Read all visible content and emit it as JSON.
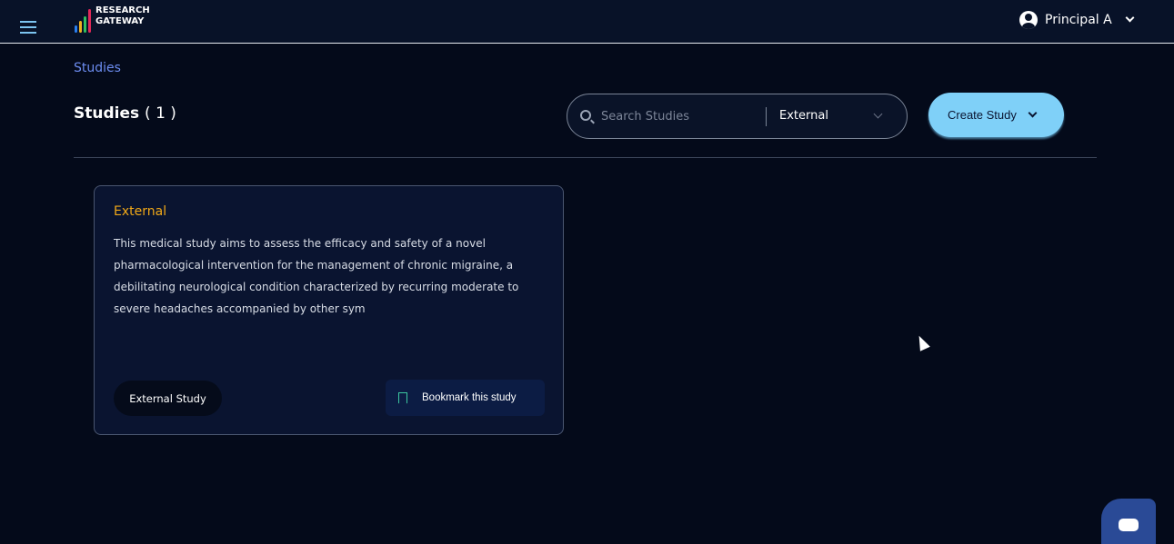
{
  "header": {
    "logo_line1": "RESEARCH",
    "logo_line2": "GATEWAY",
    "user": "Principal A",
    "logo_colors": [
      "#2a7ff0",
      "#f0b020",
      "#30c060",
      "#e02858"
    ]
  },
  "breadcrumb": "Studies",
  "page": {
    "title": "Studies",
    "count": "( 1 )"
  },
  "search": {
    "placeholder": "Search Studies",
    "value": "",
    "filter": "External"
  },
  "create_button": "Create Study",
  "studies": [
    {
      "category": "External",
      "description": "This medical study aims to assess the efficacy and safety of a novel pharmacological intervention for the management of chronic migraine, a debilitating neurological condition characterized by recurring moderate to severe headaches accompanied by other sym",
      "tag": "External Study",
      "bookmark": "Bookmark this study"
    }
  ]
}
